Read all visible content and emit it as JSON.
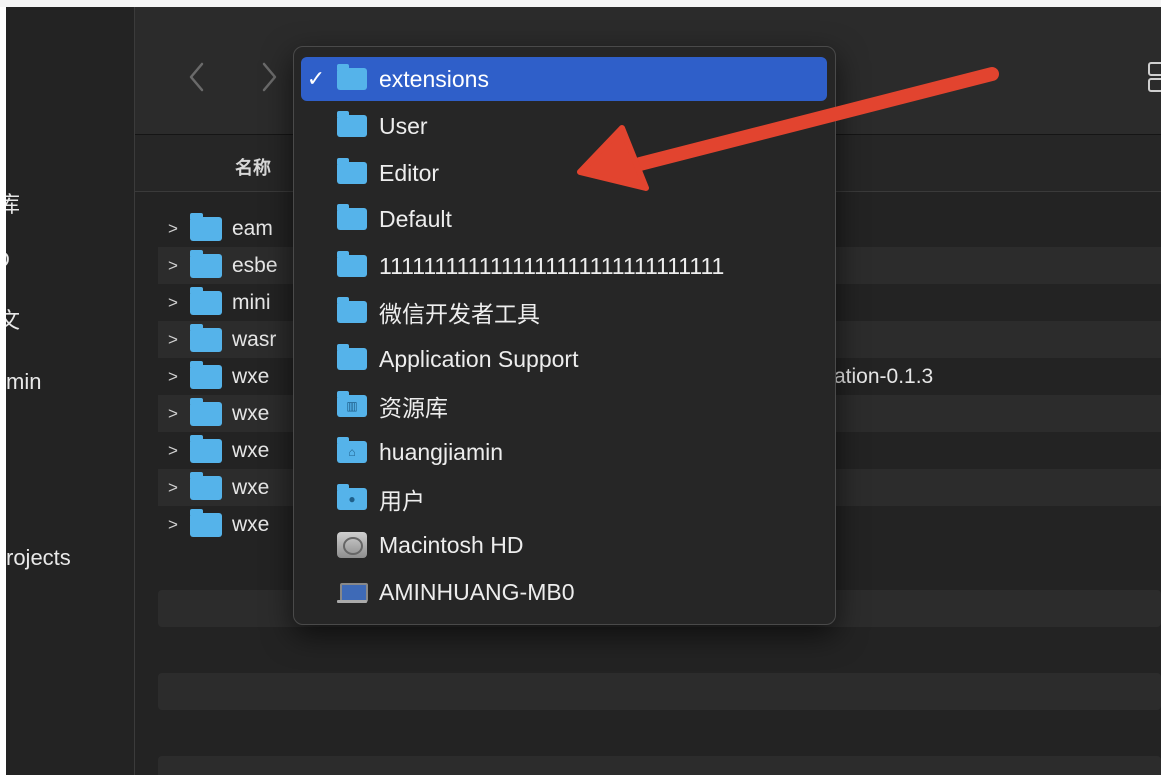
{
  "sidebar": {
    "items": [
      {
        "label": "库"
      },
      {
        "label": "D"
      },
      {
        "label": "文"
      },
      {
        "label": "min"
      },
      {
        "label": "rojects"
      }
    ]
  },
  "header": {
    "name_column": "名称"
  },
  "files": [
    {
      "name": "eam",
      "tail": ""
    },
    {
      "name": "esbe",
      "tail": ""
    },
    {
      "name": "mini",
      "tail": ""
    },
    {
      "name": "wasr",
      "tail": ""
    },
    {
      "name": "wxe",
      "tail": "ation-0.1.3"
    },
    {
      "name": "wxe",
      "tail": ""
    },
    {
      "name": "wxe",
      "tail": ""
    },
    {
      "name": "wxe",
      "tail": ""
    },
    {
      "name": "wxe",
      "tail": ""
    }
  ],
  "menu": {
    "check_mark": "✓",
    "items": [
      {
        "label": "extensions",
        "icon": "folder-icon",
        "selected": true
      },
      {
        "label": "User",
        "icon": "folder-icon"
      },
      {
        "label": "Editor",
        "icon": "folder-icon"
      },
      {
        "label": "Default",
        "icon": "folder-icon"
      },
      {
        "label": "1111111111111111111111111111111",
        "icon": "folder-icon"
      },
      {
        "label": "微信开发者工具",
        "icon": "folder-icon"
      },
      {
        "label": "Application Support",
        "icon": "folder-icon"
      },
      {
        "label": "资源库",
        "icon": "library-folder-icon"
      },
      {
        "label": "huangjiamin",
        "icon": "home-folder-icon"
      },
      {
        "label": "用户",
        "icon": "users-folder-icon"
      },
      {
        "label": "Macintosh HD",
        "icon": "hard-disk-icon"
      },
      {
        "label": "AMINHUANG-MB0",
        "icon": "laptop-icon"
      }
    ]
  },
  "colors": {
    "window_bg": "#232323",
    "selection": "#2f5fc9",
    "folder": "#55b3ea",
    "annotation_arrow": "#e2442f"
  }
}
